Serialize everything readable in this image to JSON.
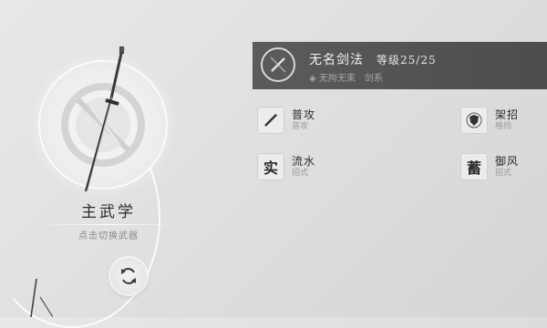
{
  "left_panel": {
    "main_label": "主武学",
    "switch_hint": "点击切换武器"
  },
  "skill_header": {
    "name": "无名剑法",
    "level": "等级25/25",
    "sub_left": "无拘无束",
    "sub_right": "剑系"
  },
  "skills": [
    {
      "name": "普攻",
      "type": "普攻",
      "icon": "sword-slash-icon"
    },
    {
      "name": "架招",
      "type": "格挡",
      "icon": "shield-icon"
    },
    {
      "name": "流水",
      "type": "招式",
      "glyph": "实"
    },
    {
      "name": "御风",
      "type": "招式",
      "glyph": "蓄"
    }
  ],
  "colors": {
    "header_bg": "#555555",
    "background": "#e2e1df",
    "accent_white": "#ffffff"
  }
}
